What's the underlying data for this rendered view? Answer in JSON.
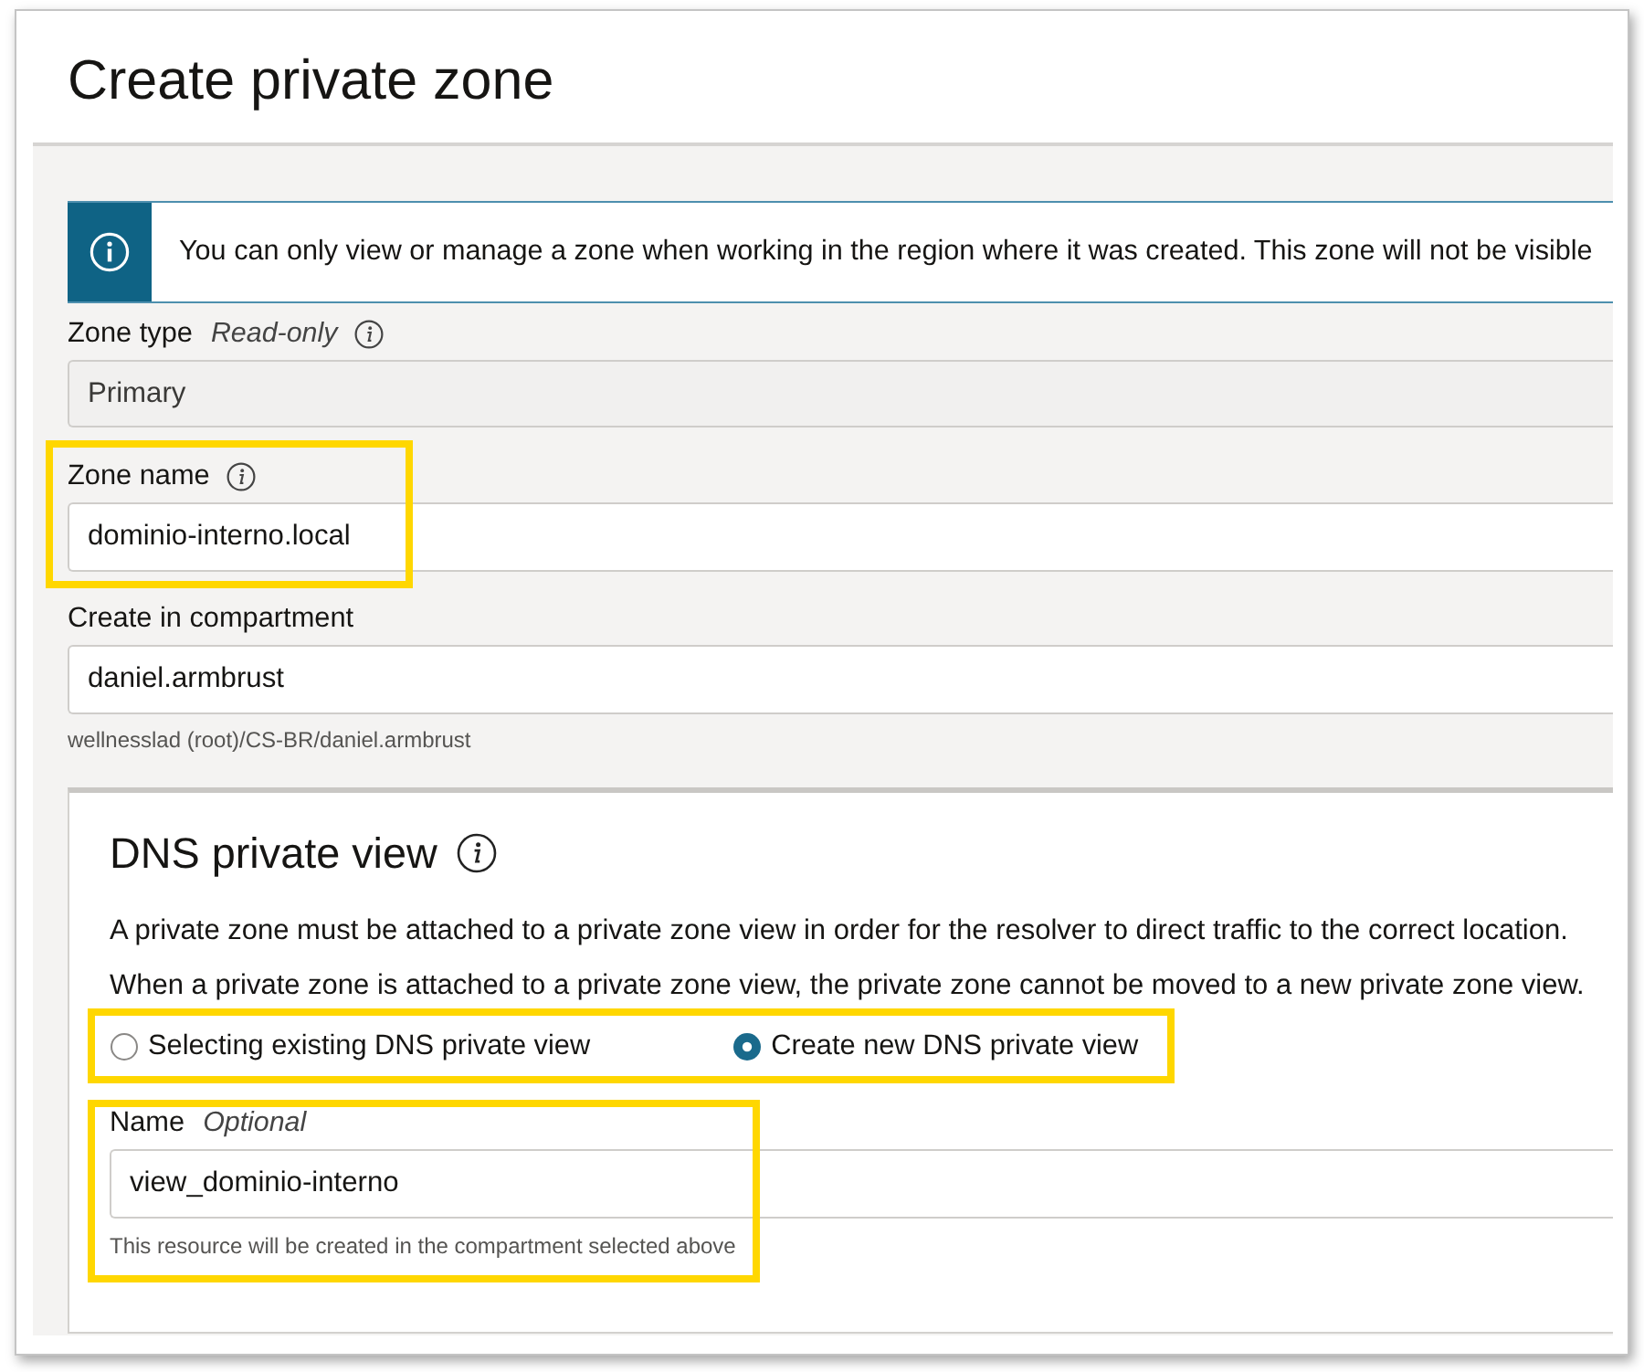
{
  "page": {
    "title": "Create private zone"
  },
  "banner": {
    "message": "You can only view or manage a zone when working in the region where it was created. This zone will not be visible"
  },
  "fields": [
    {
      "kind": "readonly",
      "label": "Zone type",
      "qualifier": "Read-only",
      "info": true,
      "value": "Primary",
      "highlighted": false
    },
    {
      "kind": "input",
      "label": "Zone name",
      "info": true,
      "value": "dominio-interno.local",
      "highlighted": true
    },
    {
      "kind": "input",
      "label": "Create in compartment",
      "info": false,
      "value": "daniel.armbrust",
      "hint": "wellnesslad (root)/CS-BR/daniel.armbrust",
      "highlighted": false
    }
  ],
  "dns_view": {
    "title": "DNS private view",
    "paragraphs": [
      "A private zone must be attached to a private zone view in order for the resolver to direct traffic to the correct location.",
      "When a private zone is attached to a private zone view, the private zone cannot be moved to a new private zone view."
    ],
    "options_highlighted": true,
    "options": [
      {
        "label": "Selecting existing DNS private view",
        "selected": false
      },
      {
        "label": "Create new DNS private view",
        "selected": true
      }
    ],
    "name_field": {
      "label": "Name",
      "qualifier": "Optional",
      "value": "view_dominio-interno",
      "hint": "This resource will be created in the compartment selected above",
      "highlighted": true
    }
  }
}
